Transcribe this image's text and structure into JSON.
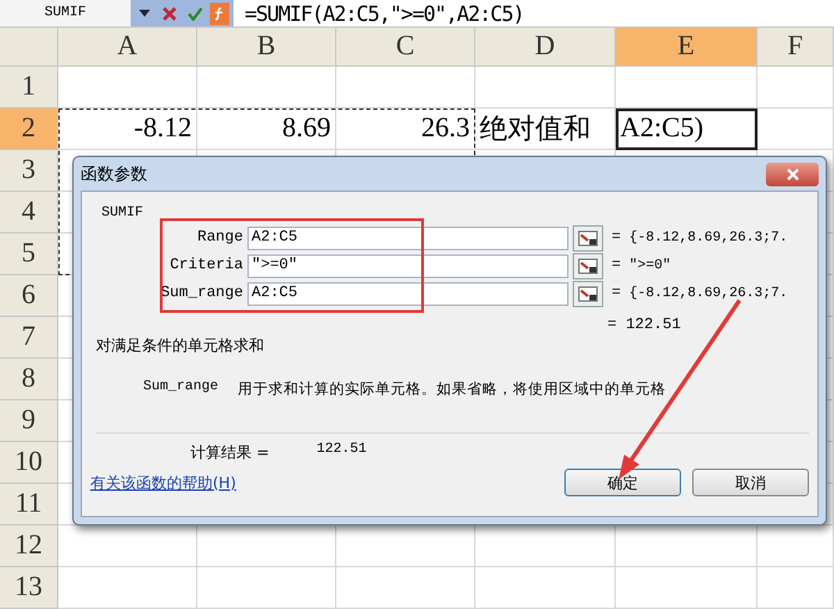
{
  "formula_bar": {
    "name_box": "SUMIF",
    "formula": "=SUMIF(A2:C5,\">=0\",A2:C5)"
  },
  "sheet": {
    "columns": [
      {
        "label": "A",
        "selected": false
      },
      {
        "label": "B",
        "selected": false
      },
      {
        "label": "C",
        "selected": false
      },
      {
        "label": "D",
        "selected": false
      },
      {
        "label": "E",
        "selected": true
      },
      {
        "label": "F",
        "selected": false
      }
    ],
    "rows": [
      {
        "label": "1",
        "selected": false
      },
      {
        "label": "2",
        "selected": true,
        "cells": [
          {
            "text": "-8.12",
            "kind": "number",
            "selected": false
          },
          {
            "text": "8.69",
            "kind": "number",
            "selected": false
          },
          {
            "text": "26.3",
            "kind": "number",
            "selected": false
          },
          {
            "text": "绝对值和",
            "kind": "text",
            "selected": false
          },
          {
            "text": "A2:C5)",
            "kind": "text",
            "selected": true
          }
        ]
      },
      {
        "label": "3",
        "selected": false
      },
      {
        "label": "4",
        "selected": false
      },
      {
        "label": "5",
        "selected": false
      },
      {
        "label": "6",
        "selected": false
      },
      {
        "label": "7",
        "selected": false
      },
      {
        "label": "8",
        "selected": false
      },
      {
        "label": "9",
        "selected": false
      },
      {
        "label": "10",
        "selected": false
      },
      {
        "label": "11",
        "selected": false
      },
      {
        "label": "12",
        "selected": false
      },
      {
        "label": "13",
        "selected": false
      }
    ],
    "copy_marquee": true
  },
  "dialog": {
    "title": "函数参数",
    "function": "SUMIF",
    "args": [
      {
        "label": "Range",
        "value": "A2:C5",
        "sign": "=",
        "result": "{-8.12,8.69,26.3;7."
      },
      {
        "label": "Criteria",
        "value": "\">=0\"",
        "sign": "=",
        "result": "\">=0\""
      },
      {
        "label": "Sum_range",
        "value": "A2:C5",
        "sign": "=",
        "result": "{-8.12,8.69,26.3;7."
      }
    ],
    "total": "= 122.51",
    "description": "对满足条件的单元格求和",
    "param_name": "Sum_range",
    "param_help": "用于求和计算的实际单元格。如果省略，将使用区域中的单元格",
    "result_label": "计算结果 =",
    "result_value": "122.51",
    "help_link": "有关该函数的帮助(H)",
    "buttons": [
      {
        "label": "确定",
        "default": true
      },
      {
        "label": "取消",
        "default": false
      }
    ]
  },
  "annotation": {
    "highlight": true,
    "arrow": true
  }
}
